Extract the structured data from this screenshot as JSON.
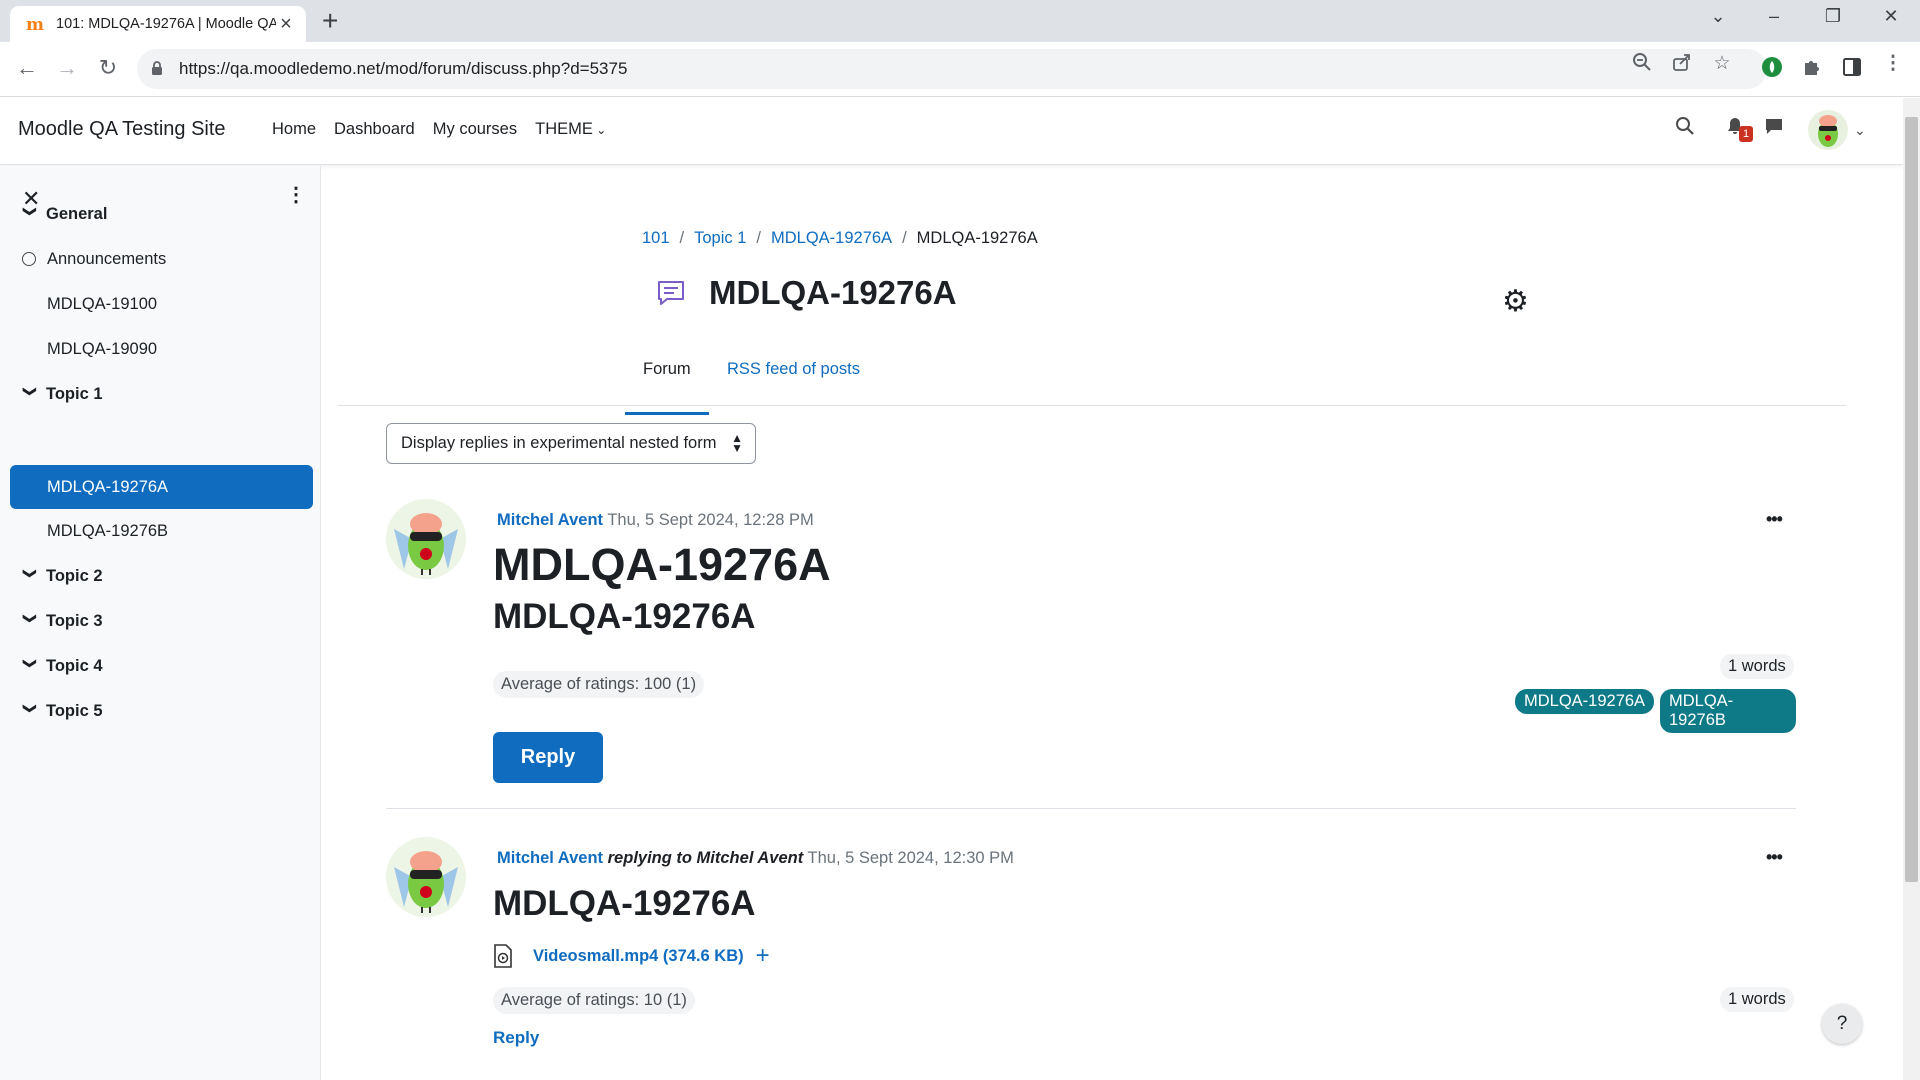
{
  "browser": {
    "tab_title": "101: MDLQA-19276A | Moodle QA",
    "url": "https://qa.moodledemo.net/mod/forum/discuss.php?d=5375"
  },
  "navbar": {
    "site_name": "Moodle QA Testing Site",
    "items": [
      "Home",
      "Dashboard",
      "My courses",
      "THEME"
    ],
    "notification_count": "1"
  },
  "drawer": {
    "items": [
      {
        "label": "General",
        "type": "section"
      },
      {
        "label": "Announcements",
        "type": "forum"
      },
      {
        "label": "MDLQA-19100",
        "type": "activity"
      },
      {
        "label": "MDLQA-19090",
        "type": "activity"
      },
      {
        "label": "Topic 1",
        "type": "section"
      },
      {
        "label": "MDLQA-19276A",
        "type": "activity",
        "active": true
      },
      {
        "label": "MDLQA-19276B",
        "type": "activity"
      },
      {
        "label": "Topic 2",
        "type": "section"
      },
      {
        "label": "Topic 3",
        "type": "section"
      },
      {
        "label": "Topic 4",
        "type": "section"
      },
      {
        "label": "Topic 5",
        "type": "section"
      }
    ]
  },
  "breadcrumb": [
    "101",
    "Topic 1",
    "MDLQA-19276A",
    "MDLQA-19276A"
  ],
  "page_title": "MDLQA-19276A",
  "tabs": {
    "forum": "Forum",
    "rss": "RSS feed of posts"
  },
  "display_mode": "Display replies in experimental nested form",
  "posts": [
    {
      "author": "Mitchel Avent",
      "date": "Thu, 5 Sept 2024, 12:28 PM",
      "subject": "MDLQA-19276A",
      "body": "MDLQA-19276A",
      "rating": "Average of ratings: 100 (1)",
      "words": "1 words",
      "tags": [
        "MDLQA-19276A",
        "MDLQA-19276B"
      ],
      "reply": "Reply"
    },
    {
      "author": "Mitchel Avent",
      "replying_to": "replying to Mitchel Avent",
      "date": "Thu, 5 Sept 2024, 12:30 PM",
      "subject": "MDLQA-19276A",
      "attachment": "Videosmall.mp4 (374.6 KB)",
      "rating": "Average of ratings: 10 (1)",
      "words": "1 words",
      "reply": "Reply"
    }
  ],
  "help": "?",
  "colors": {
    "primary": "#0f6cbf",
    "tag": "#0f7a87",
    "badge": "#ca3120"
  }
}
